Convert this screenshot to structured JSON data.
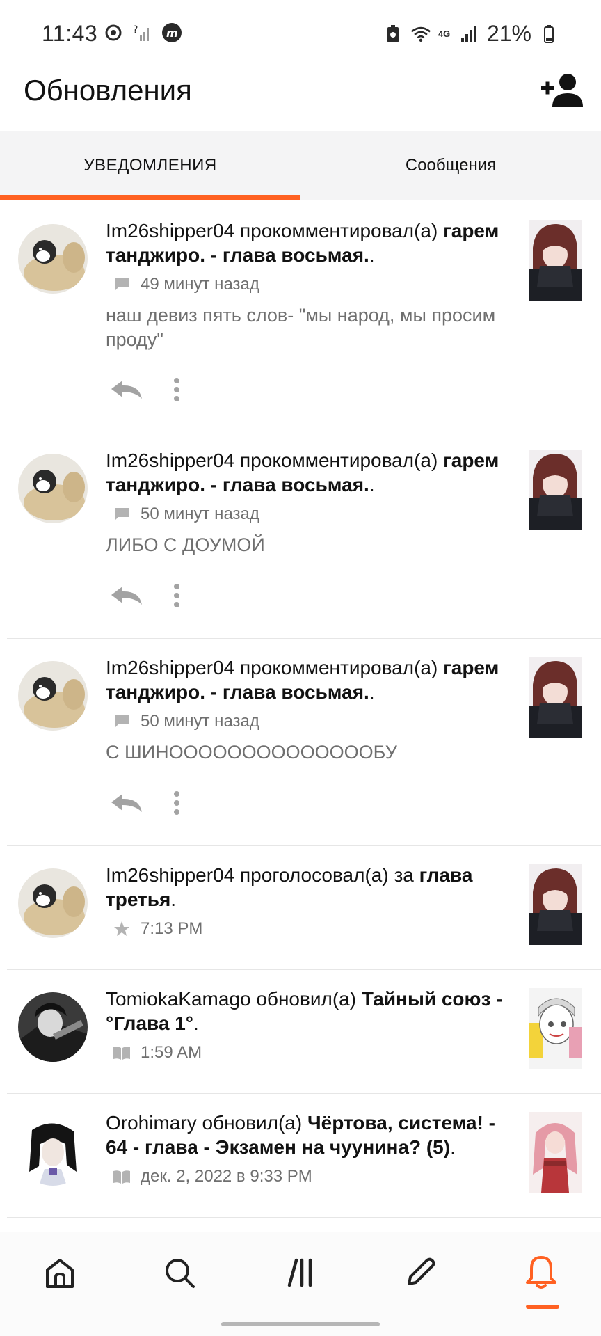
{
  "status_bar": {
    "time": "11:43",
    "battery": "21%",
    "network": "4G"
  },
  "header": {
    "title": "Обновления",
    "add_friend_icon": "add-person-icon"
  },
  "tabs": [
    {
      "label": "УВЕДОМЛЕНИЯ",
      "active": true
    },
    {
      "label": "Сообщения",
      "active": false
    }
  ],
  "colors": {
    "accent": "#ff6122",
    "text_primary": "#121212",
    "text_secondary": "#6f6f6f"
  },
  "notifications": [
    {
      "user": "Im26shipper04",
      "action": "прокомментировал(а)",
      "target": "гарем танджиро. - глава восьмая.",
      "target_suffix": ".",
      "meta_icon": "comment-icon",
      "time": "49 минут назад",
      "comment": "наш девиз пять слов- \"мы народ, мы просим проду\""
    },
    {
      "user": "Im26shipper04",
      "action": "прокомментировал(а)",
      "target": "гарем танджиро. - глава восьмая.",
      "target_suffix": ".",
      "meta_icon": "comment-icon",
      "time": "50 минут назад",
      "comment": "ЛИБО С ДОУМОЙ"
    },
    {
      "user": "Im26shipper04",
      "action": "прокомментировал(а)",
      "target": "гарем танджиро. - глава восьмая.",
      "target_suffix": ".",
      "meta_icon": "comment-icon",
      "time": "50 минут назад",
      "comment": "С ШИНООООООООООООООБУ"
    },
    {
      "user": "Im26shipper04",
      "action": "проголосовал(а) за",
      "target": "глава третья",
      "target_suffix": ".",
      "meta_icon": "star-icon",
      "time": "7:13 PM"
    },
    {
      "user": "TomiokaKamago",
      "action": "обновил(а)",
      "target": "Тайный союз - °Глава 1°",
      "target_suffix": ".",
      "meta_icon": "book-icon",
      "time": "1:59 AM"
    },
    {
      "user": "Orohimary",
      "action": "обновил(а)",
      "target": "Чёртова, система! - 64 - глава - Экзамен на чуунина? (5)",
      "target_suffix": ".",
      "meta_icon": "book-icon",
      "time": "дек. 2, 2022 в 9:33 PM"
    }
  ],
  "bottom_nav": [
    {
      "icon": "home-icon",
      "active": false
    },
    {
      "icon": "search-icon",
      "active": false
    },
    {
      "icon": "library-icon",
      "active": false
    },
    {
      "icon": "pencil-icon",
      "active": false
    },
    {
      "icon": "bell-icon",
      "active": true
    }
  ]
}
